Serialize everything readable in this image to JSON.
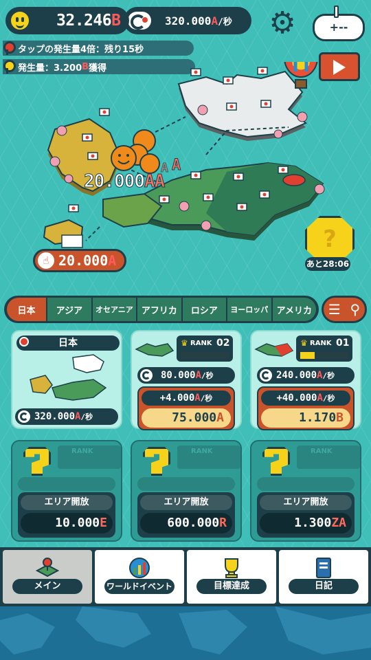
{
  "hud": {
    "currency_value": "32.246",
    "currency_unit": "B",
    "rate_value": "320.000",
    "rate_unit": "A",
    "rate_suffix": "/秒",
    "controller_label": "+--"
  },
  "notices": [
    {
      "text": "タップの発生量4倍：残り15秒",
      "color": "#e04030"
    },
    {
      "text_pre": "発生量：3.200",
      "text_unit": "B",
      "text_post": "獲得",
      "color": "#f6d21a"
    }
  ],
  "map": {
    "tap_popup_value": "20.000",
    "tap_popup_unit": "AA",
    "floating_units": [
      "A",
      "A"
    ],
    "tap_cost_value": "20.000",
    "tap_cost_unit": "A",
    "mystery_box_label": "?",
    "mystery_box_timer": "あと28:06"
  },
  "tabs": [
    {
      "label": "日本",
      "active": true
    },
    {
      "label": "アジア",
      "active": false
    },
    {
      "label": "オセアニア",
      "active": false
    },
    {
      "label": "アフリカ",
      "active": false
    },
    {
      "label": "ロシア",
      "active": false
    },
    {
      "label": "ヨーロッパ",
      "active": false
    },
    {
      "label": "アメリカ",
      "active": false
    }
  ],
  "list_button_icon": "list-icon",
  "japan_card": {
    "title": "日本",
    "rate_value": "320.000",
    "rate_unit": "A",
    "rate_suffix": "/秒"
  },
  "region_cards": [
    {
      "rank_label": "RANK",
      "rank_value": "02",
      "rank_progress": 0,
      "rate_value": "80.000",
      "rate_unit": "A",
      "rate_suffix": "/秒",
      "increment_value": "+4.000",
      "increment_unit": "A",
      "increment_suffix": "/秒",
      "cost_value": "75.000",
      "cost_unit": "A"
    },
    {
      "rank_label": "RANK",
      "rank_value": "01",
      "rank_progress": 0.3,
      "rate_value": "240.000",
      "rate_unit": "A",
      "rate_suffix": "/秒",
      "increment_value": "+40.000",
      "increment_unit": "A",
      "increment_suffix": "/秒",
      "cost_value": "1.170",
      "cost_unit": "B"
    }
  ],
  "locked_cards": [
    {
      "rank_label": "RANK",
      "unlock_label": "エリア開放",
      "cost_value": "10.000",
      "cost_unit": "E"
    },
    {
      "rank_label": "RANK",
      "unlock_label": "エリア開放",
      "cost_value": "600.000",
      "cost_unit": "R"
    },
    {
      "rank_label": "RANK",
      "unlock_label": "エリア開放",
      "cost_value": "1.300",
      "cost_unit": "ZA"
    }
  ],
  "bottom_nav": [
    {
      "label": "メイン",
      "icon": "map-pin-icon",
      "active": true
    },
    {
      "label": "ワールドイベント",
      "icon": "globe-chart-icon",
      "active": false
    },
    {
      "label": "目標達成",
      "icon": "trophy-icon",
      "active": false
    },
    {
      "label": "日記",
      "icon": "notebook-icon",
      "active": false
    }
  ],
  "colors": {
    "background": "#3fbfb8",
    "panel_dark": "#1d3f4a",
    "accent_orange": "#c9542c",
    "accent_yellow": "#f6d21a",
    "unit_red": "#ff5a5a"
  }
}
